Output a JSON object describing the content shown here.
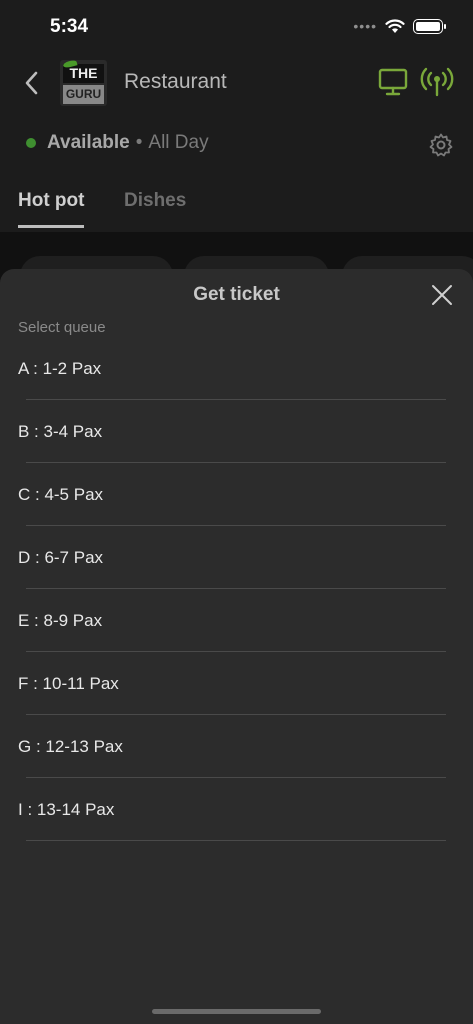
{
  "status_bar": {
    "time": "5:34",
    "signal_dots": "••••"
  },
  "header": {
    "title": "Restaurant",
    "logo_top": "THE",
    "logo_bottom": "GURU"
  },
  "availability": {
    "label": "Available",
    "separator": "•",
    "time": "All Day"
  },
  "tabs": [
    {
      "label": "Hot pot",
      "active": true
    },
    {
      "label": "Dishes",
      "active": false
    }
  ],
  "sheet": {
    "title": "Get ticket",
    "select_label": "Select queue",
    "queues": [
      {
        "label": "A : 1-2 Pax"
      },
      {
        "label": "B : 3-4 Pax"
      },
      {
        "label": "C : 4-5 Pax"
      },
      {
        "label": "D : 6-7 Pax"
      },
      {
        "label": "E : 8-9 Pax"
      },
      {
        "label": "F : 10-11 Pax"
      },
      {
        "label": "G : 12-13 Pax"
      },
      {
        "label": "I : 13-14 Pax"
      }
    ]
  },
  "colors": {
    "accent_green": "#7aa83a",
    "status_green": "#3f8f30",
    "sheet_bg": "#2c2c2c"
  },
  "icons": [
    "back-chevron-icon",
    "monitor-icon",
    "broadcast-signal-icon",
    "gear-icon",
    "close-icon",
    "wifi-icon",
    "battery-icon"
  ]
}
